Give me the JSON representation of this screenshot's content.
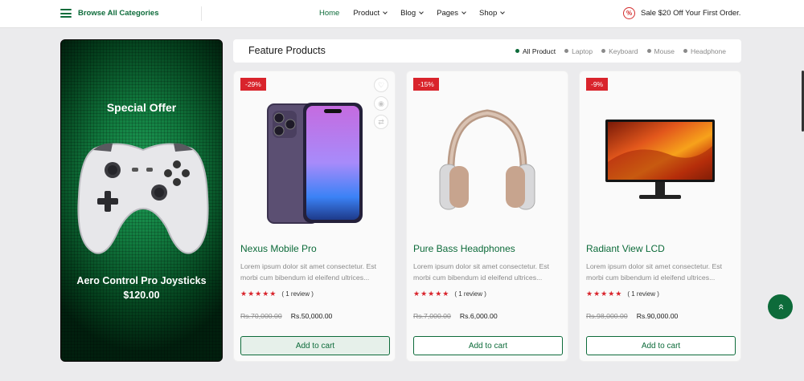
{
  "header": {
    "browse_label": "Browse All Categories",
    "nav": [
      {
        "label": "Home",
        "active": true,
        "dropdown": false
      },
      {
        "label": "Product",
        "active": false,
        "dropdown": true
      },
      {
        "label": "Blog",
        "active": false,
        "dropdown": true
      },
      {
        "label": "Pages",
        "active": false,
        "dropdown": true
      },
      {
        "label": "Shop",
        "active": false,
        "dropdown": true
      }
    ],
    "promo_text": "Sale $20 Off Your First Order."
  },
  "banner": {
    "title": "Special Offer",
    "product_name": "Aero Control Pro Joysticks",
    "price": "$120.00"
  },
  "feature": {
    "title": "Feature Products",
    "tabs": [
      {
        "label": "All Product",
        "active": true
      },
      {
        "label": "Laptop",
        "active": false
      },
      {
        "label": "Keyboard",
        "active": false
      },
      {
        "label": "Mouse",
        "active": false
      },
      {
        "label": "Headphone",
        "active": false
      }
    ]
  },
  "products": [
    {
      "discount": "-29%",
      "name": "Nexus Mobile Pro",
      "description": "Lorem ipsum dolor sit amet consectetur. Est morbi cum bibendum id eleifend ultrices...",
      "stars": "★★★★★",
      "reviews": "( 1 review )",
      "old_price": "Rs.70,000.00",
      "price": "Rs.50,000.00",
      "cart_label": "Add to cart"
    },
    {
      "discount": "-15%",
      "name": "Pure Bass Headphones",
      "description": "Lorem ipsum dolor sit amet consectetur. Est morbi cum bibendum id eleifend ultrices...",
      "stars": "★★★★★",
      "reviews": "( 1 review )",
      "old_price": "Rs.7,000.00",
      "price": "Rs.6,000.00",
      "cart_label": "Add to cart"
    },
    {
      "discount": "-9%",
      "name": "Radiant View LCD",
      "description": "Lorem ipsum dolor sit amet consectetur. Est morbi cum bibendum id eleifend ultrices...",
      "stars": "★★★★★",
      "reviews": "( 1 review )",
      "old_price": "Rs.98,000.00",
      "price": "Rs.90,000.00",
      "cart_label": "Add to cart"
    }
  ],
  "icons": {
    "menu": "hamburger-icon",
    "promo": "percent-icon",
    "wishlist": "heart-icon",
    "quickview": "eye-icon",
    "compare": "compare-icon",
    "scroll_top": "double-chevron-up-icon"
  },
  "colors": {
    "brand_green": "#0d6b3a",
    "discount_red": "#d9242c",
    "star_red": "#d9242c"
  }
}
